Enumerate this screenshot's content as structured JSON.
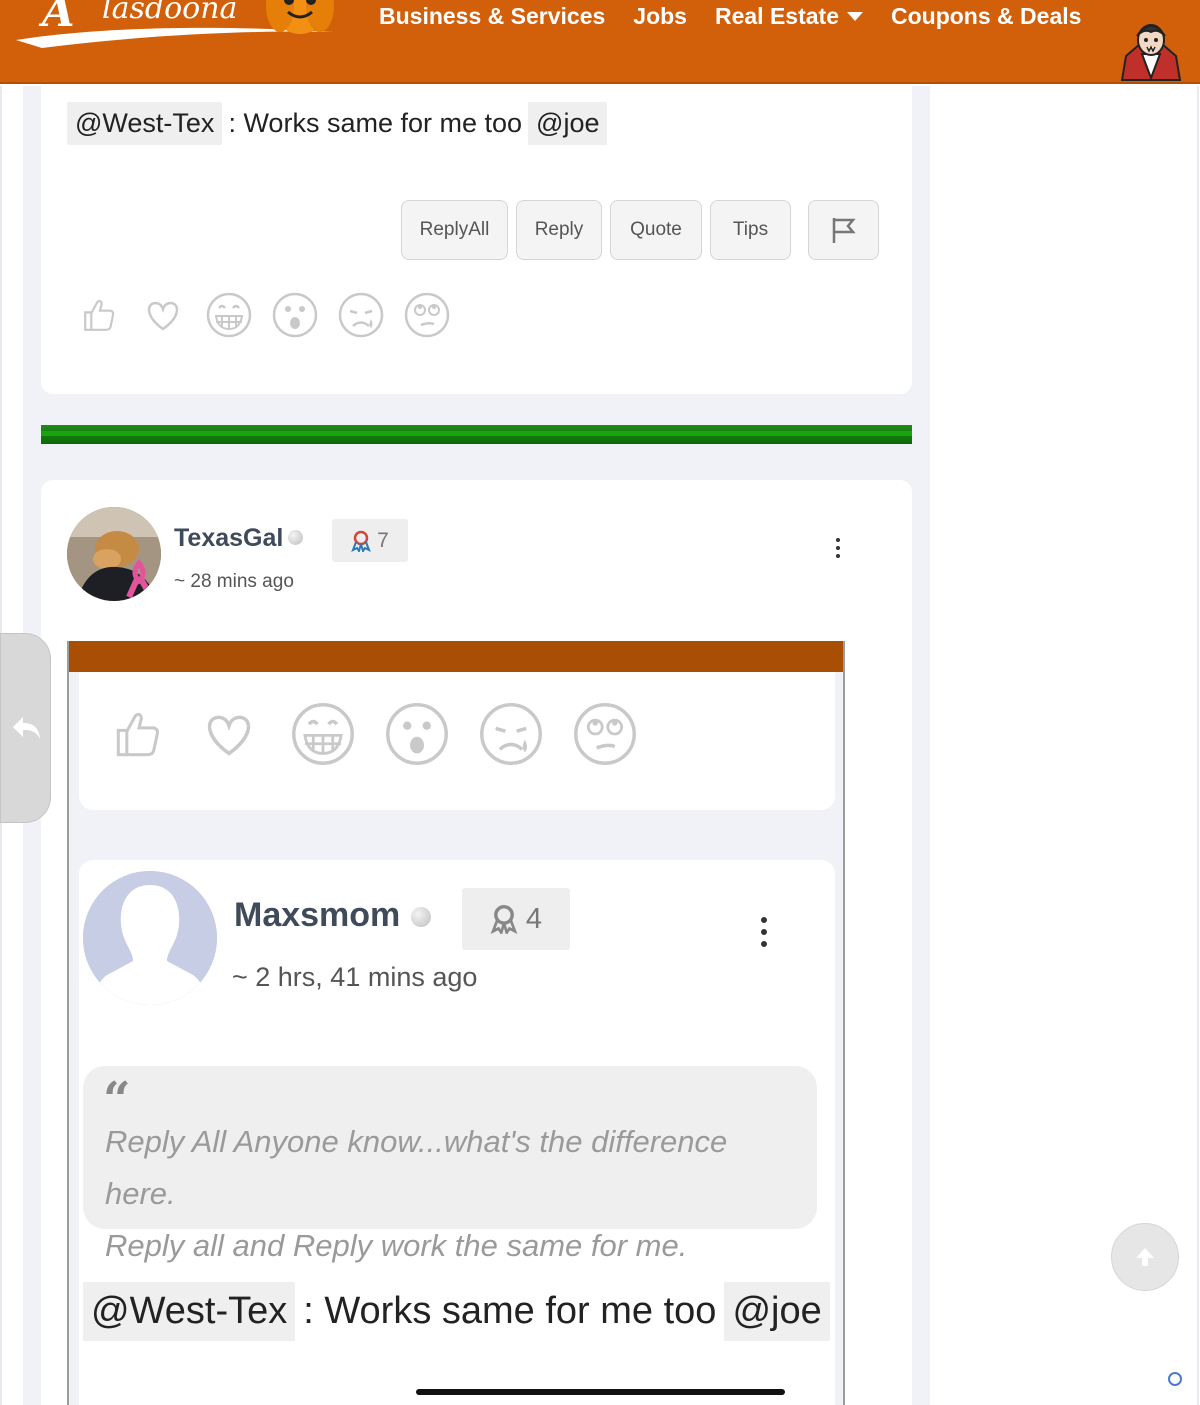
{
  "header": {
    "logo_text": "Alasdoona",
    "nav": [
      {
        "label": "Business & Services"
      },
      {
        "label": "Jobs"
      },
      {
        "label": "Real Estate",
        "has_dropdown": true
      },
      {
        "label": "Coupons & Deals"
      }
    ],
    "brand_color": "#d2600b",
    "user_avatar_icon": "vampire-avatar-icon"
  },
  "post1": {
    "mention_from": "@West-Tex",
    "message": ": Works same for me too",
    "mention_to": "@joe",
    "buttons": {
      "reply_all": "ReplyAll",
      "reply": "Reply",
      "quote": "Quote",
      "tips": "Tips"
    },
    "flag_icon": "flag-icon",
    "reactions": [
      "like-icon",
      "heart-icon",
      "grin-icon",
      "wow-icon",
      "sad-icon",
      "eyeroll-icon"
    ]
  },
  "divider_color": "#1e8c16",
  "post2": {
    "author": "TexasGal",
    "badge_count": "7",
    "time": "~ 28 mins ago",
    "menu_icon": "more-vertical-icon",
    "embedded": {
      "bar_color": "#a94f05",
      "reactions": [
        "like-icon",
        "heart-icon",
        "grin-icon",
        "wow-icon",
        "sad-icon",
        "eyeroll-icon"
      ],
      "author": "Maxsmom",
      "badge_count": "4",
      "time": "~ 2 hrs, 41 mins ago",
      "quote_lines": [
        "Reply All Anyone know...what's the difference here.",
        "Reply all and Reply work the same for me."
      ],
      "mention_from": "@West-Tex",
      "message": ": Works same for me too",
      "mention_to": "@joe"
    }
  },
  "side_tab_icon": "back-arrow-icon",
  "scroll_top_icon": "arrow-up-icon"
}
